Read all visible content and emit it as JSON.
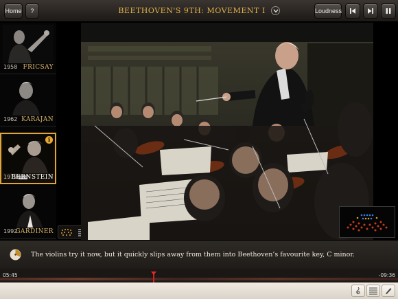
{
  "header": {
    "home_label": "Home",
    "help_label": "?",
    "title": "BEETHOVEN'S 9TH: MOVEMENT I",
    "loudness_label": "Loudness",
    "prev_icon": "skip-back-icon",
    "next_icon": "skip-forward-icon",
    "pause_icon": "pause-icon"
  },
  "conductors": [
    {
      "year": "1958",
      "name": "FRICSAY",
      "dvd": "",
      "active": false
    },
    {
      "year": "1962",
      "name": "KARAJAN",
      "dvd": "",
      "active": false
    },
    {
      "year": "1979",
      "name": "BERNSTEIN",
      "dvd": "DVD",
      "active": true,
      "info": "i"
    },
    {
      "year": "1992",
      "name": "GARDINER",
      "dvd": "",
      "active": false
    }
  ],
  "caption": {
    "text": "The violins try it now, but it quickly slips away from them into Beethoven’s favourite key, C minor."
  },
  "timeline": {
    "elapsed": "05:45",
    "remaining": "-09:36",
    "progress": 0.385
  },
  "colors": {
    "accent": "#e3b24a",
    "playhead": "#d62020"
  }
}
